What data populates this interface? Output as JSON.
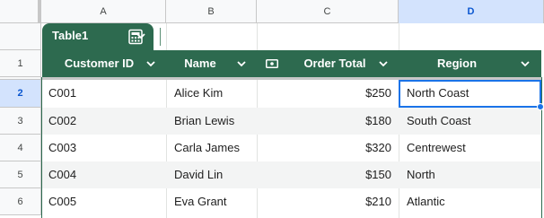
{
  "column_headers": [
    "A",
    "B",
    "C",
    "D"
  ],
  "selected_column": "D",
  "row_headers": [
    "1",
    "2",
    "3",
    "4",
    "5",
    "6"
  ],
  "selected_row": "2",
  "table": {
    "name": "Table1",
    "tab_icons": [
      "chevron-down-icon",
      "calculator-icon"
    ],
    "accent_color": "#2d6a4f",
    "columns": [
      {
        "label": "Customer ID",
        "type_icon": ""
      },
      {
        "label": "Name",
        "type_icon": ""
      },
      {
        "label": "Order Total",
        "type_icon": "currency-icon"
      },
      {
        "label": "Region",
        "type_icon": ""
      }
    ],
    "rows": [
      {
        "id": "C001",
        "name": "Alice Kim",
        "total": "$250",
        "region": "North Coast"
      },
      {
        "id": "C002",
        "name": "Brian Lewis",
        "total": "$180",
        "region": "South Coast"
      },
      {
        "id": "C003",
        "name": "Carla James",
        "total": "$320",
        "region": "Centrewest"
      },
      {
        "id": "C004",
        "name": "David Lin",
        "total": "$150",
        "region": "North"
      },
      {
        "id": "C005",
        "name": "Eva Grant",
        "total": "$210",
        "region": "Atlantic"
      }
    ]
  },
  "selection_color": "#1a73e8"
}
